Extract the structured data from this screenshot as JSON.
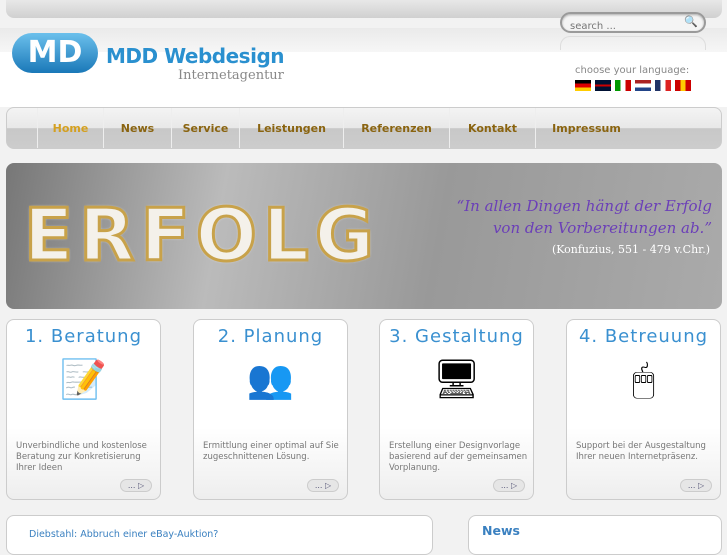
{
  "header": {
    "brand": "MDD Webdesign",
    "tagline": "Internetagentur",
    "logo_text": "MD",
    "search_placeholder": "search ...",
    "language_label": "choose your language:",
    "flags": [
      {
        "name": "flag-de",
        "colors": [
          "#000",
          "#d00",
          "#fc0"
        ]
      },
      {
        "name": "flag-en",
        "colors": [
          "#013",
          "#c00",
          "#fff"
        ]
      },
      {
        "name": "flag-it",
        "colors": [
          "#090",
          "#fff",
          "#c00"
        ]
      },
      {
        "name": "flag-nl",
        "colors": [
          "#a22",
          "#fff",
          "#248"
        ]
      },
      {
        "name": "flag-fr",
        "colors": [
          "#236",
          "#fff",
          "#d22"
        ]
      },
      {
        "name": "flag-es",
        "colors": [
          "#c00",
          "#fc0",
          "#c00"
        ]
      }
    ]
  },
  "nav": {
    "items": [
      {
        "label": "Home",
        "active": true
      },
      {
        "label": "News"
      },
      {
        "label": "Service"
      },
      {
        "label": "Leistungen"
      },
      {
        "label": "Referenzen"
      },
      {
        "label": "Kontakt"
      },
      {
        "label": "Impressum"
      }
    ]
  },
  "banner": {
    "word": "ERFOLG",
    "quote_line1": "“In allen Dingen hängt der Erfolg",
    "quote_line2": "von den Vorbereitungen ab.”",
    "author": "(Konfuzius, 551 - 479 v.Chr.)"
  },
  "cards": [
    {
      "title": "1. Beratung",
      "icon": "📝",
      "icon_name": "document-pencil-icon",
      "text": "Unverbindliche und kostenlose Beratung zur Konkretisierung Ihrer Ideen",
      "more": "... ▷"
    },
    {
      "title": "2. Planung",
      "icon": "👥",
      "icon_name": "users-icon",
      "text": "Ermittlung einer optimal auf Sie zugeschnittenen Lösung.",
      "more": "... ▷"
    },
    {
      "title": "3. Gestaltung",
      "icon": "🖥",
      "icon_name": "monitor-icon",
      "text": "Erstellung einer Designvorlage basierend auf der gemeinsamen Vorplanung.",
      "more": "... ▷"
    },
    {
      "title": "4. Betreuung",
      "icon": "🖱",
      "icon_name": "mouse-icon",
      "text": "Support bei der Ausgestaltung Ihrer neuen Internetpräsenz.",
      "more": "... ▷"
    }
  ],
  "article": {
    "link": "Diebstahl: Abbruch einer eBay-Auktion?"
  },
  "news": {
    "title": "News"
  }
}
